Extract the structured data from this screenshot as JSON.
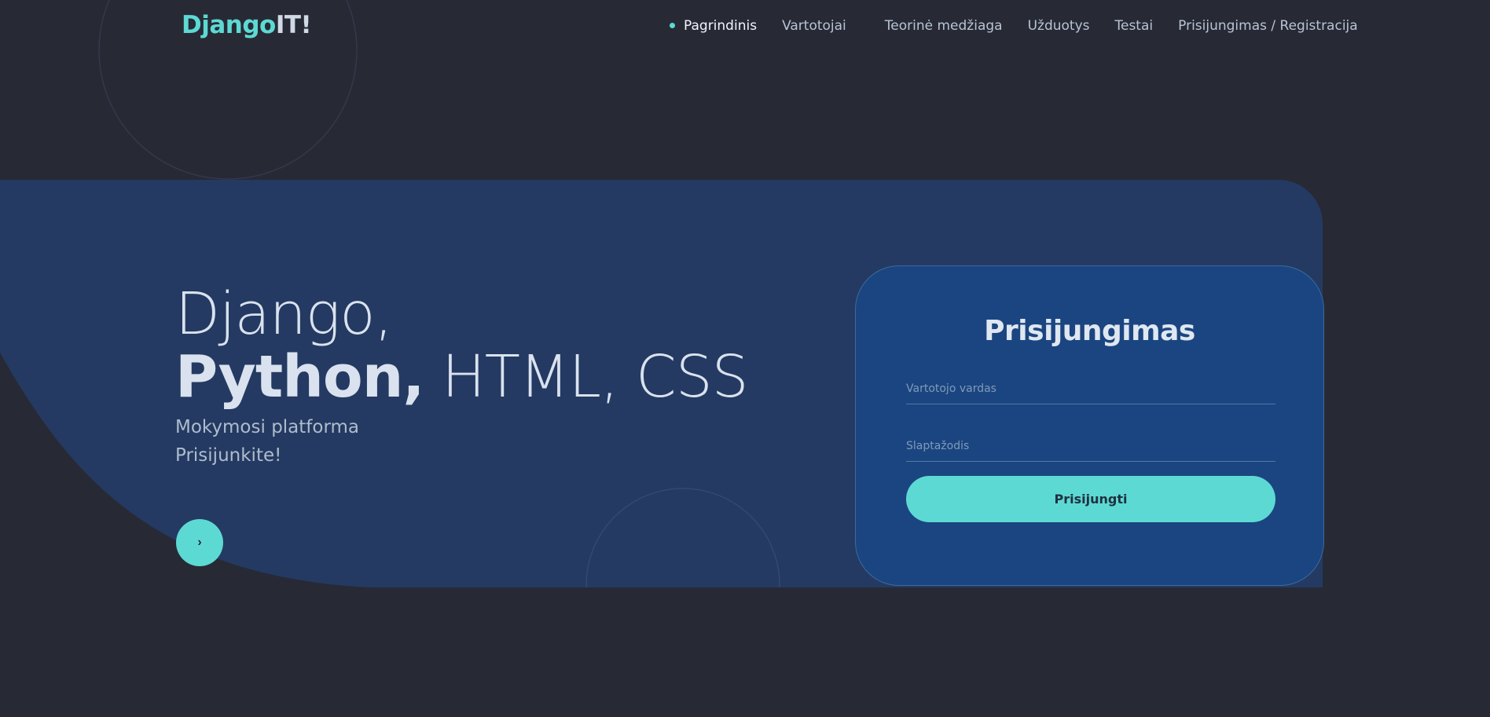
{
  "brand": {
    "part1": "Django",
    "part2": "IT!"
  },
  "nav": {
    "items": [
      {
        "label": "Pagrindinis",
        "active": true
      },
      {
        "label": "Vartotojai",
        "active": false
      },
      {
        "label": "Teorinė medžiaga",
        "active": false
      },
      {
        "label": "Užduotys",
        "active": false
      },
      {
        "label": "Testai",
        "active": false
      },
      {
        "label": "Prisijungimas / Registracija",
        "active": false
      }
    ]
  },
  "hero": {
    "line1": "Django,",
    "line2_bold": "Python,",
    "line2_light": " HTML, CSS",
    "subtitle1": "Mokymosi platforma",
    "subtitle2": "Prisijunkite!",
    "arrow_symbol": "›"
  },
  "login": {
    "title": "Prisijungimas",
    "username_placeholder": "Vartotojo vardas",
    "password_placeholder": "Slaptažodis",
    "submit_label": "Prisijungti"
  },
  "colors": {
    "background": "#272a35",
    "hero_panel": "#243a62",
    "card": "#1b4580",
    "accent": "#5dd9d3",
    "text": "#d9e2ee"
  }
}
